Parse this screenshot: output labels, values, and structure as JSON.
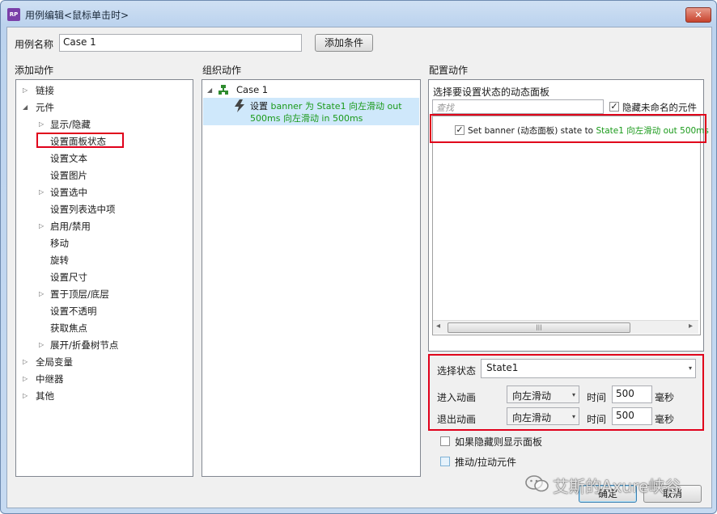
{
  "window": {
    "title": "用例编辑<鼠标单击时>",
    "app_icon": "RP",
    "close_glyph": "✕"
  },
  "case_name": {
    "label": "用例名称",
    "value": "Case 1"
  },
  "add_condition_label": "添加条件",
  "add_action": {
    "header": "添加动作",
    "items": [
      {
        "label": "链接",
        "expand": "▷"
      },
      {
        "label": "元件",
        "expand": "◢"
      },
      {
        "label": "显示/隐藏",
        "expand": "▷"
      },
      {
        "label": "设置面板状态",
        "expand": ""
      },
      {
        "label": "设置文本",
        "expand": ""
      },
      {
        "label": "设置图片",
        "expand": ""
      },
      {
        "label": "设置选中",
        "expand": "▷"
      },
      {
        "label": "设置列表选中项",
        "expand": ""
      },
      {
        "label": "启用/禁用",
        "expand": "▷"
      },
      {
        "label": "移动",
        "expand": ""
      },
      {
        "label": "旋转",
        "expand": ""
      },
      {
        "label": "设置尺寸",
        "expand": ""
      },
      {
        "label": "置于顶层/底层",
        "expand": "▷"
      },
      {
        "label": "设置不透明",
        "expand": ""
      },
      {
        "label": "获取焦点",
        "expand": ""
      },
      {
        "label": "展开/折叠树节点",
        "expand": "▷"
      },
      {
        "label": "全局变量",
        "expand": "▷"
      },
      {
        "label": "中继器",
        "expand": "▷"
      },
      {
        "label": "其他",
        "expand": "▷"
      }
    ]
  },
  "organize": {
    "header": "组织动作",
    "case_label": "Case 1",
    "case_expand": "◢",
    "action_prefix": "设置",
    "action_green_1": "banner 为 State1 向左滑动 out",
    "action_green_2": "500ms 向左滑动 in 500ms"
  },
  "configure": {
    "header": "配置动作",
    "select_panel_label": "选择要设置状态的动态面板",
    "search_placeholder": "查找",
    "hide_unnamed_label": "隐藏未命名的元件",
    "hide_unnamed_checked": "✓",
    "panel_row_check": "✓",
    "panel_row_black": "Set banner (动态面板) state to ",
    "panel_row_green": "State1 向左滑动 out 500ms",
    "select_state_label": "选择状态",
    "state_value": "State1",
    "enter_anim_label": "进入动画",
    "exit_anim_label": "退出动画",
    "enter_anim_value": "向左滑动",
    "exit_anim_value": "向左滑动",
    "time_label": "时间",
    "enter_time": "500",
    "exit_time": "500",
    "ms_label": "毫秒",
    "show_if_hidden_label": "如果隐藏则显示面板",
    "push_pull_label": "推动/拉动元件"
  },
  "ok_label": "确定",
  "cancel_label": "取消",
  "watermark": "艾斯的Axure峡谷",
  "scroll_thumb_glyph": "|||",
  "scroll_left_glyph": "◂",
  "scroll_right_glyph": "▸",
  "dropdown_glyph": "▾"
}
